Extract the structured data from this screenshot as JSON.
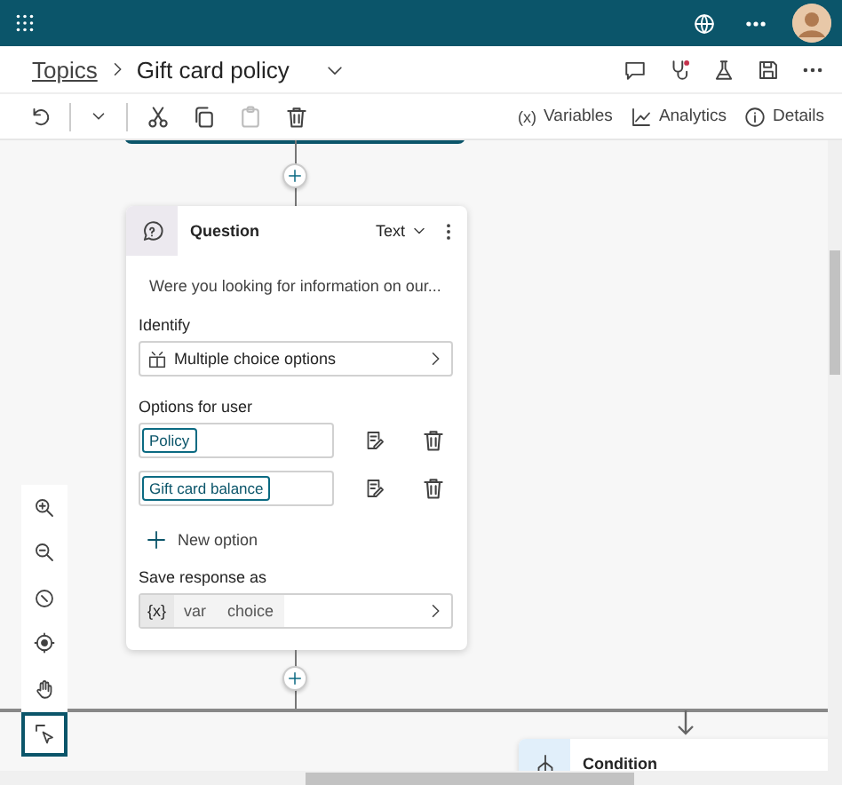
{
  "breadcrumb": {
    "parent": "Topics",
    "current": "Gift card policy"
  },
  "toolbar": {
    "tools": [
      {
        "kind": "cut",
        "disabled": false
      },
      {
        "kind": "copy",
        "disabled": false
      },
      {
        "kind": "paste",
        "disabled": true
      },
      {
        "kind": "delete",
        "disabled": false
      }
    ],
    "links": [
      {
        "glyph": "(x)",
        "label": "Variables"
      },
      {
        "kind": "analytics",
        "label": "Analytics"
      },
      {
        "kind": "details",
        "label": "Details"
      }
    ]
  },
  "question_node": {
    "title": "Question",
    "type": "Text",
    "message": "Were you looking for information on our...",
    "identify_label": "Identify",
    "identify_value": "Multiple choice options",
    "options_label": "Options for user",
    "options": [
      {
        "value": "Policy"
      },
      {
        "value": "Gift card balance"
      }
    ],
    "new_option": "New option",
    "save_label": "Save response as",
    "save_variable": {
      "glyph": "{x}",
      "scope": "var",
      "name": "choice"
    }
  },
  "condition_node": {
    "title": "Condition"
  },
  "canvas_tools": [
    {
      "kind": "zoom-in",
      "selected": false
    },
    {
      "kind": "zoom-out",
      "selected": false
    },
    {
      "kind": "reset",
      "selected": false
    },
    {
      "kind": "center",
      "selected": false
    },
    {
      "kind": "pan",
      "selected": false
    },
    {
      "kind": "select",
      "selected": true
    }
  ]
}
